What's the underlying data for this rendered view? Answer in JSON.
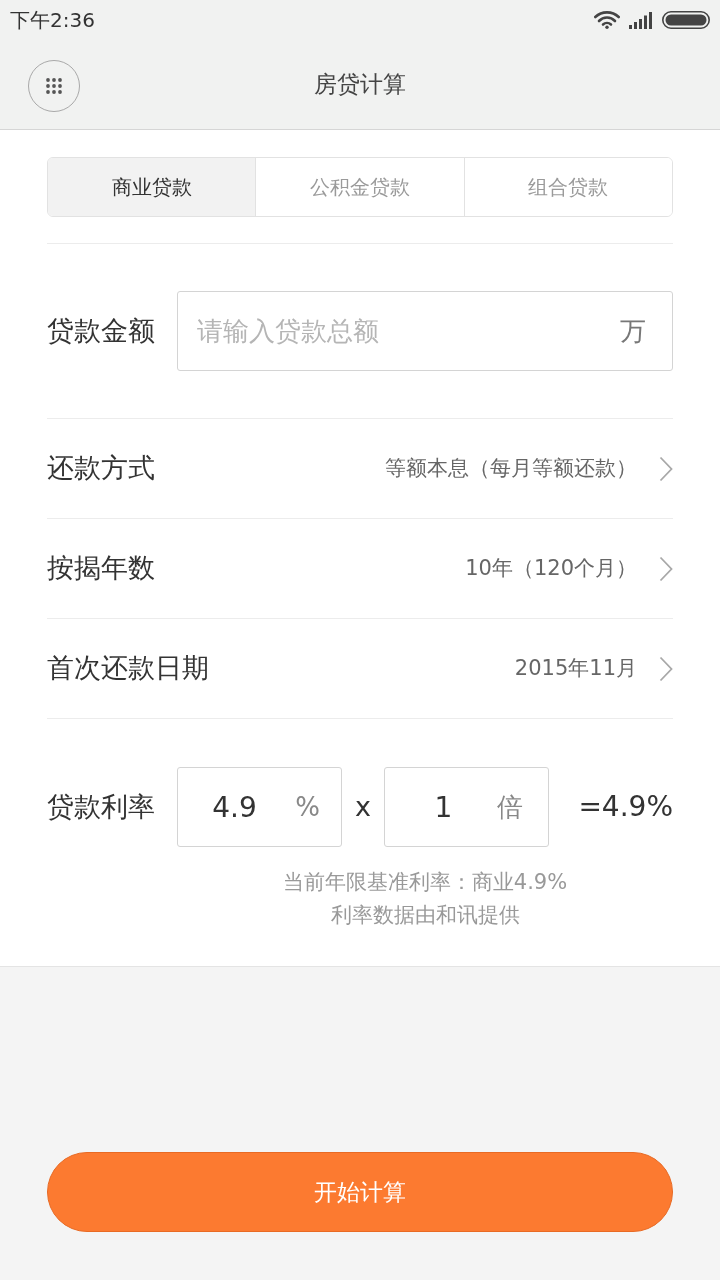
{
  "status_bar": {
    "time": "下午2:36"
  },
  "header": {
    "title": "房贷计算"
  },
  "loan_tabs": [
    {
      "label": "商业贷款",
      "selected": true
    },
    {
      "label": "公积金贷款",
      "selected": false
    },
    {
      "label": "组合贷款",
      "selected": false
    }
  ],
  "loan_amount": {
    "label": "贷款金额",
    "placeholder": "请输入贷款总额",
    "unit": "万"
  },
  "options": [
    {
      "label": "还款方式",
      "value": "等额本息（每月等额还款）"
    },
    {
      "label": "按揭年数",
      "value": "10年（120个月）"
    },
    {
      "label": "首次还款日期",
      "value": "2015年11月"
    }
  ],
  "interest_rate": {
    "label": "贷款利率",
    "rate": "4.9",
    "rate_unit": "%",
    "operator": "x",
    "multiplier": "1",
    "multiplier_unit": "倍",
    "result": "=4.9%"
  },
  "notes": [
    "当前年限基准利率：商业4.9%",
    "利率数据由和讯提供"
  ],
  "calculate_button": {
    "label": "开始计算"
  }
}
